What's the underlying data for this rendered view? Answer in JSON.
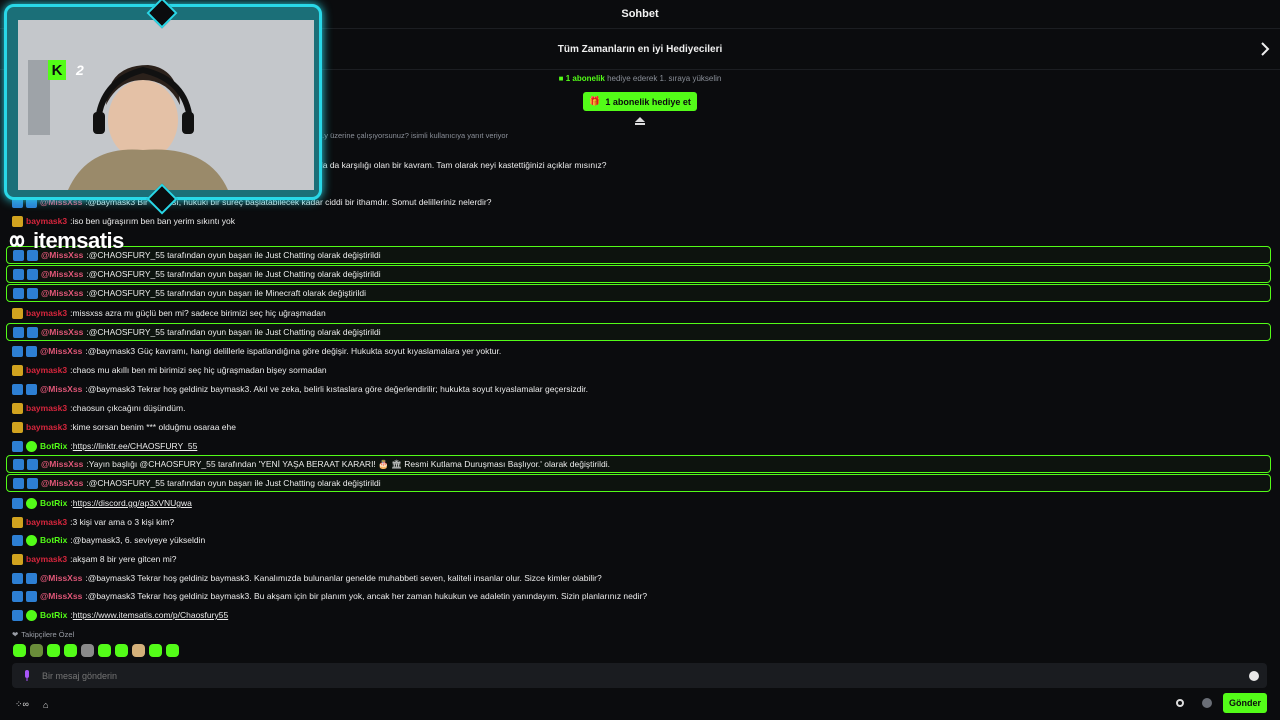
{
  "header": {
    "title": "Sohbet"
  },
  "leaderboard": {
    "title": "Tüm Zamanların en iyi Hediyecileri"
  },
  "gift": {
    "banner_highlight": "1 abonelik",
    "banner_rest": " hediye ederek 1. sıraya yükselin",
    "button_label": "1 abonelik hediye et"
  },
  "stream": {
    "channel_number": "2"
  },
  "watermark": {
    "text": "itemsatis"
  },
  "chat": {
    "messages": [
      {
        "text": "...y üzerine çalışıyorsunuz? isimli kullanıcıya yanıt veriyor",
        "top": 0
      },
      {
        "text": "da da karşılığı olan bir kavram. Tam olarak neyi kastettiğinizi açıklar mısınız?"
      },
      {
        "user": "@MissXss",
        "text": "@baymask3 Bir \"h... ası, hukuki bir süreç başlatabilecek kadar ciddi bir ithamdır. Somut delilleriniz nelerdir?"
      },
      {
        "user": "baymask3",
        "text": "iso ben uğraşırım ben ban yerim sıkıntı yok"
      },
      {
        "user": "@MissXss",
        "text": "@CHAOSFURY_55 tarafından oyun başarı ile Just Chatting olarak değiştirildi",
        "hl": true
      },
      {
        "user": "@MissXss",
        "text": "@CHAOSFURY_55 tarafından oyun başarı ile Just Chatting olarak değiştirildi",
        "hl": true
      },
      {
        "user": "@MissXss",
        "text": "@CHAOSFURY_55 tarafından oyun başarı ile Minecraft olarak değiştirildi",
        "hl": true
      },
      {
        "user": "baymask3",
        "text": "missxss azra mı güçlü ben mi? sadece birimizi seç hiç uğraşmadan"
      },
      {
        "user": "@MissXss",
        "text": "@CHAOSFURY_55 tarafından oyun başarı ile Just Chatting olarak değiştirildi",
        "hl": true
      },
      {
        "user": "@MissXss",
        "text": "@baymask3 Güç kavramı, hangi delillerle ispatlandığına göre değişir. Hukukta soyut kıyaslamalara yer yoktur."
      },
      {
        "user": "baymask3",
        "text": "chaos mu akıllı ben mi birimizi seç hiç uğraşmadan bişey sormadan"
      },
      {
        "user": "@MissXss",
        "text": "@baymask3 Tekrar hoş geldiniz baymask3. Akıl ve zeka, belirli kıstaslara göre değerlendirilir; hukukta soyut kıyaslamalar geçersizdir."
      },
      {
        "user": "baymask3",
        "text": "chaosun çıkcağını düşündüm."
      },
      {
        "user": "baymask3",
        "text": "kime sorsan benim *** olduğmu osaraa ehe"
      },
      {
        "user": "BotRix",
        "text": "https://linktr.ee/CHAOSFURY_55",
        "link": true
      },
      {
        "user": "@MissXss",
        "text": "Yayın başlığı @CHAOSFURY_55 tarafından 'YENİ YAŞA BERAAT KARARI! 🎂 🏛 Resmi Kutlama Duruşması Başlıyor.' olarak değiştirildi.",
        "hl": true
      },
      {
        "user": "@MissXss",
        "text": "@CHAOSFURY_55 tarafından oyun başarı ile Just Chatting olarak değiştirildi",
        "hl": true
      },
      {
        "user": "BotRix",
        "text": "https://discord.gg/ap3xVNUgwa",
        "link": true
      },
      {
        "user": "baymask3",
        "text": "3 kişi var ama o 3 kişi kim?"
      },
      {
        "user": "BotRix",
        "text": "@baymask3, 6. seviyeye yükseldin"
      },
      {
        "user": "baymask3",
        "text": "akşam 8 bir yere gitcen mi?"
      },
      {
        "user": "@MissXss",
        "text": "@baymask3 Tekrar hoş geldiniz baymask3. Kanalımızda bulunanlar genelde muhabbeti seven, kaliteli insanlar olur. Sizce kimler olabilir?"
      },
      {
        "user": "@MissXss",
        "text": "@baymask3 Tekrar hoş geldiniz baymask3. Bu akşam için bir planım yok, ancak her zaman hukukun ve adaletin yanındayım. Sizin planlarınız nedir?"
      },
      {
        "user": "BotRix",
        "text": "https://www.itemsatis.com/p/Chaosfury55",
        "link": true
      }
    ]
  },
  "emotes": {
    "label": "Takipçilere Özel"
  },
  "input": {
    "placeholder": "Bir mesaj gönderin"
  },
  "footer": {
    "send_label": "Gönder",
    "points": "∞"
  },
  "colors": {
    "accent": "#53fc18",
    "frame": "#29d8e8"
  }
}
